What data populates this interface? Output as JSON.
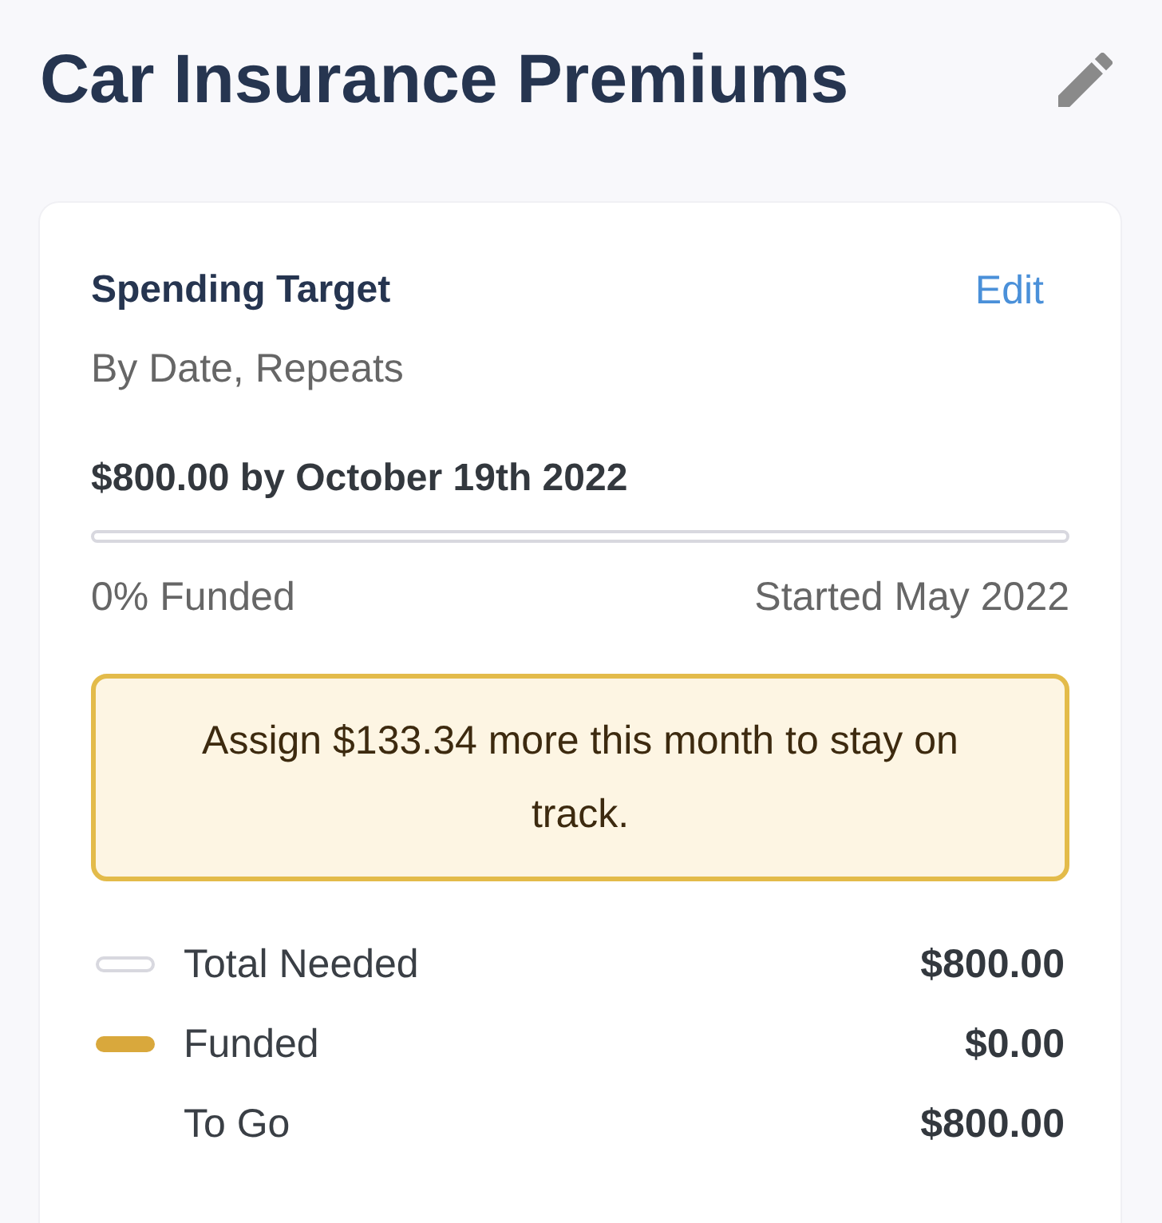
{
  "header": {
    "title": "Car Insurance Premiums"
  },
  "target": {
    "heading": "Spending Target",
    "edit_label": "Edit",
    "subtitle": "By Date, Repeats",
    "goal": "$800.00 by October 19th 2022",
    "funded_label": "0% Funded",
    "started_label": "Started May 2022",
    "alert": "Assign $133.34 more this month to stay on track.",
    "legend": [
      {
        "kind": "track",
        "label": "Total Needed",
        "value": "$800.00"
      },
      {
        "kind": "fill",
        "label": "Funded",
        "value": "$0.00"
      },
      {
        "kind": "plain",
        "label": "To Go",
        "value": "$800.00"
      }
    ]
  }
}
